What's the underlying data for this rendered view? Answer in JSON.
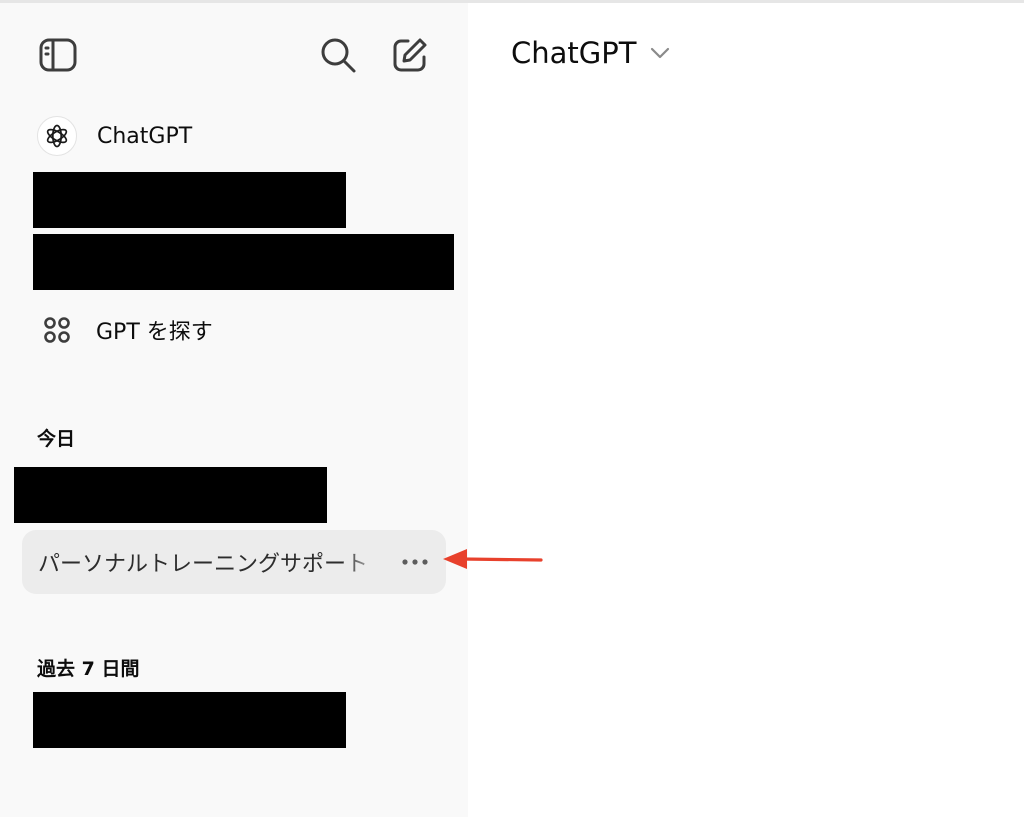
{
  "sidebar": {
    "toggle_icon": "sidebar-toggle-icon",
    "search_icon": "search-icon",
    "new_chat_icon": "new-chat-icon",
    "items": [
      {
        "label": "ChatGPT",
        "icon": "chatgpt-logo-icon"
      },
      {
        "label": "GPT を探す",
        "icon": "grid-icon"
      }
    ],
    "sections": [
      {
        "title": "今日",
        "chats": [
          {
            "title": "[redacted]"
          },
          {
            "title": "パーソナルトレーニングサポート",
            "selected": true,
            "more_icon": "more-horizontal-icon"
          }
        ]
      },
      {
        "title": "過去 7 日間",
        "chats": [
          {
            "title": "[redacted]"
          }
        ]
      }
    ]
  },
  "main": {
    "model_selector": {
      "label": "ChatGPT",
      "icon": "chevron-down-icon"
    }
  },
  "annotation": {
    "type": "arrow",
    "color": "#e8412c"
  },
  "colors": {
    "sidebar_bg": "#f9f9f9",
    "selected_bg": "#ececec",
    "text": "#0d0d0d",
    "annotation": "#e8412c"
  }
}
